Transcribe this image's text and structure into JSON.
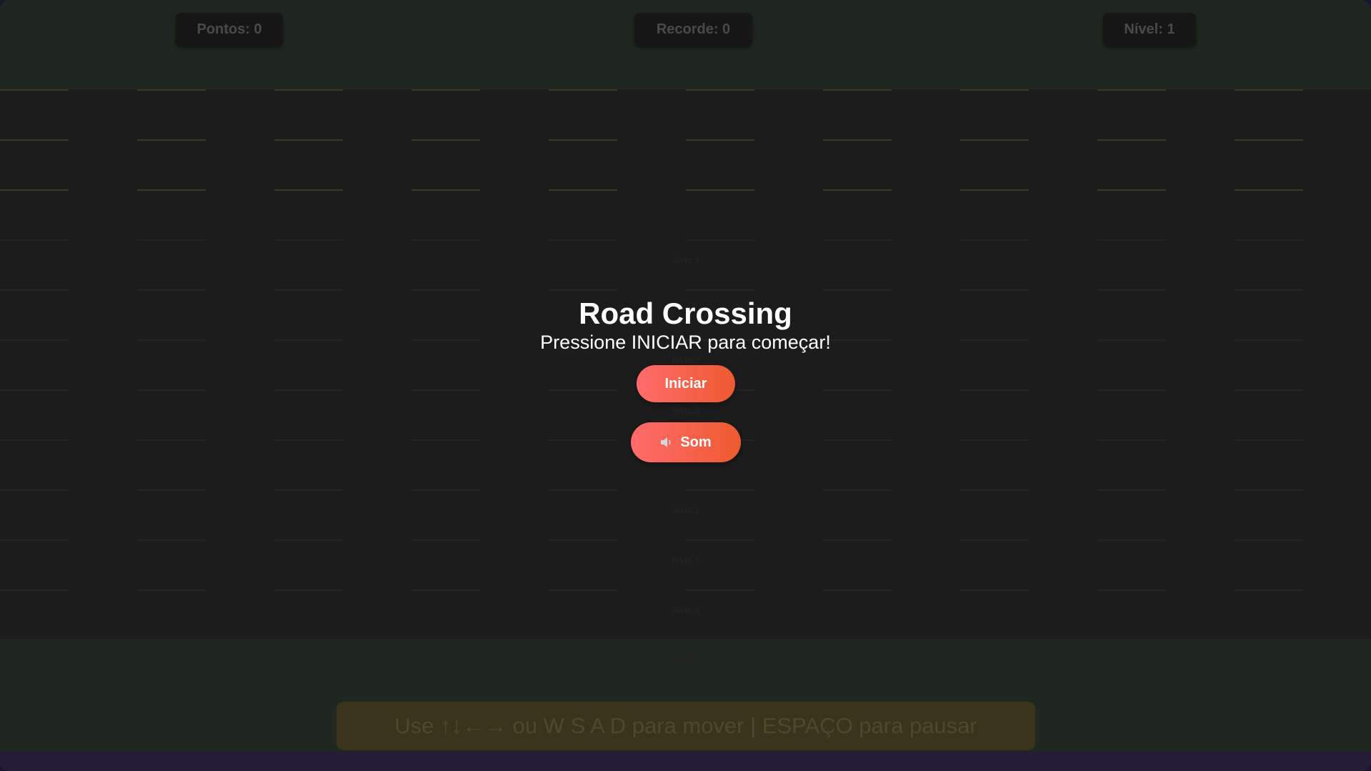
{
  "hud": {
    "score_label": "Pontos: 0",
    "record_label": "Recorde: 0",
    "level_label": "Nível: 1"
  },
  "lanes": {
    "labels": [
      "NÍVEL 3",
      "NÍVEL 2",
      "NÍVEL 4",
      "NÍVEL 1",
      "NÍVEL 1",
      "NÍVEL 4",
      "NÍVEL 5"
    ]
  },
  "menu": {
    "title": "Road Crossing",
    "subtitle": "Pressione INICIAR para começar!",
    "start_label": "Iniciar",
    "sound_label": "Som",
    "sound_icon": "speaker-icon"
  },
  "instructions": "Use ↑↓←→ ou W S A D para mover | ESPAÇO para pausar",
  "colors": {
    "accent_start": "#ff6b6b",
    "accent_end": "#ee5a2f",
    "road": "#1c1c1c",
    "grass": "#1f2820"
  }
}
